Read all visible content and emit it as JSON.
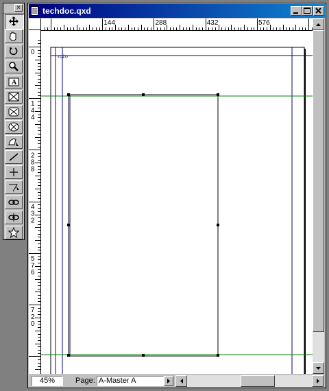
{
  "window": {
    "title": "techdoc.qxd"
  },
  "tools": [
    {
      "name": "item-tool",
      "icon": "move-arrows-icon"
    },
    {
      "name": "content-tool",
      "icon": "hand-icon"
    },
    {
      "name": "rotation-tool",
      "icon": "rotate-icon"
    },
    {
      "name": "zoom-tool",
      "icon": "magnifier-icon"
    },
    {
      "name": "text-box-tool",
      "icon": "text-box-icon"
    },
    {
      "name": "rect-picture-box-tool",
      "icon": "rect-picture-box-icon"
    },
    {
      "name": "rounded-picture-box-tool",
      "icon": "rounded-picture-box-icon"
    },
    {
      "name": "oval-picture-box-tool",
      "icon": "oval-picture-box-icon"
    },
    {
      "name": "bezier-picture-box-tool",
      "icon": "bezier-picture-box-icon"
    },
    {
      "name": "line-tool",
      "icon": "line-icon"
    },
    {
      "name": "orthogonal-line-tool",
      "icon": "orthogonal-line-icon"
    },
    {
      "name": "bezier-line-tool",
      "icon": "bezier-line-icon"
    },
    {
      "name": "linking-tool",
      "icon": "link-icon"
    },
    {
      "name": "unlinking-tool",
      "icon": "unlink-icon"
    },
    {
      "name": "star-tool",
      "icon": "star-icon"
    }
  ],
  "ruler": {
    "horizontal_labels": [
      "144",
      "288",
      "432",
      "576"
    ],
    "vertical_labels": [
      "0",
      "144",
      "288",
      "432",
      "576",
      "720"
    ]
  },
  "canvas": {
    "page_number_marker": "‹‹#››"
  },
  "status": {
    "zoom": "45%",
    "page_label": "Page:",
    "page_value": "A-Master A"
  }
}
